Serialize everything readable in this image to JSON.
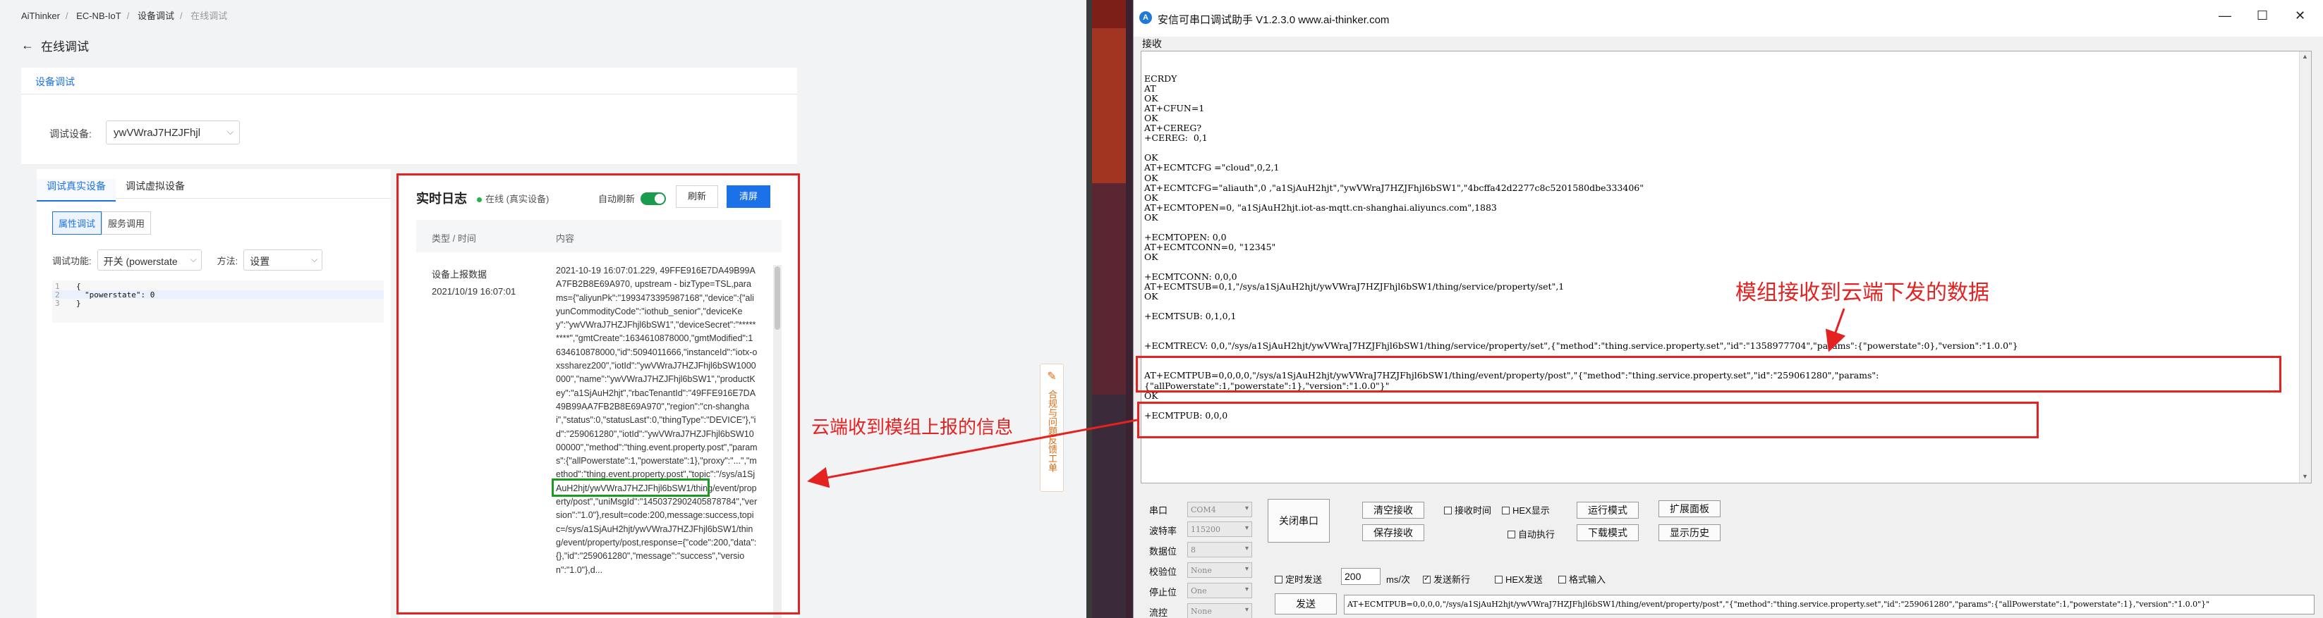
{
  "console": {
    "breadcrumb": [
      "AiThinker",
      "EC-NB-IoT",
      "设备调试",
      "在线调试"
    ],
    "back_label": "在线调试",
    "top_tab": "设备调试",
    "device_label": "调试设备:",
    "device_value": "ywVWraJ7HZJFhjl",
    "subtabs": [
      "调试真实设备",
      "调试虚拟设备"
    ],
    "seg": [
      "属性调试",
      "服务调用"
    ],
    "func_label": "调试功能:",
    "func_value": "开关 (powerstate",
    "method_label": "方法:",
    "method_value": "设置",
    "code": {
      "ln1": "1",
      "ln2": "2",
      "ln3": "3",
      "line1": "{",
      "line2": "\"powerstate\": 0",
      "line3": "}"
    },
    "log": {
      "title": "实时日志",
      "status": "在线 (真实设备)",
      "auto_refresh": "自动刷新",
      "refresh": "刷新",
      "clear": "清屏",
      "col_type": "类型 / 时间",
      "col_content": "内容",
      "entry_type": "设备上报数据",
      "entry_time": "2021/10/19 16:07:01",
      "entry_content": "2021-10-19 16:07:01.229, 49FFE916E7DA49B99AA7FB2B8E69A970, upstream - bizType=TSL,params={\"aliyunPk\":\"1993473395987168\",\"device\":{\"aliyunCommodityCode\":\"iothub_senior\",\"deviceKey\":\"ywVWraJ7HZJFhjl6bSW1\",\"deviceSecret\":\"*********\",\"gmtCreate\":1634610878000,\"gmtModified\":1634610878000,\"id\":5094011666,\"instanceId\":\"iotx-oxssharez200\",\"iotId\":\"ywVWraJ7HZJFhjl6bSW1000000\",\"name\":\"ywVWraJ7HZJFhjl6bSW1\",\"productKey\":\"a1SjAuH2hjt\",\"rbacTenantId\":\"49FFE916E7DA49B99AA7FB2B8E69A970\",\"region\":\"cn-shanghai\",\"status\":0,\"statusLast\":0,\"thingType\":\"DEVICE\"},\"id\":\"259061280\",\"iotId\":\"ywVWraJ7HZJFhjl6bSW1000000\",\"method\":\"thing.event.property.post\",\"params\":{\"allPowerstate\":1,\"powerstate\":1},\"proxy\":\"...\",\"method\":\"thing.event.property.post\",\"topic\":\"/sys/a1SjAuH2hjt/ywVWraJ7HZJFhjl6bSW1/thing/event/property/post\",\"uniMsgId\":\"1450372902405878784\",\"version\":\"1.0\"},result=code:200,message:success,topic=/sys/a1SjAuH2hjt/ywVWraJ7HZJFhjl6bSW1/thing/event/property/post,response={\"code\":200,\"data\":{},\"id\":\"259061280\",\"message\":\"success\",\"version\":\"1.0\"},d..."
    },
    "feedback": "合规与问题反馈工单",
    "annotation": "云端收到模组上报的信息"
  },
  "serial": {
    "title": "安信可串口调试助手 V1.2.3.0    www.ai-thinker.com",
    "recv_label": "接收",
    "annotation": "模组接收到云端下发的数据",
    "recv_lines": [
      "",
      "ECRDY",
      "AT",
      "OK",
      "AT+CFUN=1",
      "OK",
      "AT+CEREG?",
      "+CEREG:  0,1",
      "",
      "OK",
      "AT+ECMTCFG =\"cloud\",0,2,1",
      "OK",
      "AT+ECMTCFG=\"aliauth\",0 ,\"a1SjAuH2hjt\",\"ywVWraJ7HZJFhjl6bSW1\",\"4bcffa42d2277c8c5201580dbe333406\"",
      "OK",
      "AT+ECMTOPEN=0, \"a1SjAuH2hjt.iot-as-mqtt.cn-shanghai.aliyuncs.com\",1883",
      "OK",
      "",
      "+ECMTOPEN: 0,0",
      "AT+ECMTCONN=0, \"12345\"",
      "OK",
      "",
      "+ECMTCONN: 0,0,0",
      "AT+ECMTSUB=0,1,\"/sys/a1SjAuH2hjt/ywVWraJ7HZJFhjl6bSW1/thing/service/property/set\",1",
      "OK",
      "",
      "+ECMTSUB: 0,1,0,1",
      "",
      "",
      "+ECMTRECV: 0,0,\"/sys/a1SjAuH2hjt/ywVWraJ7HZJFhjl6bSW1/thing/service/property/set\",{\"method\":\"thing.service.property.set\",\"id\":\"1358977704\",\"params\":{\"powerstate\":0},\"version\":\"1.0.0\"}",
      "",
      "",
      "AT+ECMTPUB=0,0,0,0,\"/sys/a1SjAuH2hjt/ywVWraJ7HZJFhjl6bSW1/thing/event/property/post\",\"{\"method\":\"thing.service.property.set\",\"id\":\"259061280\",\"params\":",
      "{\"allPowerstate\":1,\"powerstate\":1},\"version\":\"1.0.0\"}\"",
      "OK",
      "",
      "+ECMTPUB: 0,0,0"
    ],
    "port_label": "串口",
    "port_value": "COM4",
    "baud_label": "波特率",
    "baud_value": "115200",
    "databits_label": "数据位",
    "databits_value": "8",
    "parity_label": "校验位",
    "parity_value": "None",
    "stopbits_label": "停止位",
    "stopbits_value": "One",
    "flow_label": "流控",
    "flow_value": "None",
    "close_port": "关闭串口",
    "clear_recv": "清空接收",
    "save_recv": "保存接收",
    "recv_time": "接收时间",
    "hex_show": "HEX显示",
    "auto_exec": "自动执行",
    "run_mode": "运行模式",
    "download_mode": "下载模式",
    "ext_panel": "扩展面板",
    "show_history": "显示历史",
    "timed_send": "定时发送",
    "interval": "200",
    "interval_unit": "ms/次",
    "send_newline": "发送新行",
    "hex_send": "HEX发送",
    "format_input": "格式输入",
    "send": "发送",
    "send_text": "AT+ECMTPUB=0,0,0,0,\"/sys/a1SjAuH2hjt/ywVWraJ7HZJFhjl6bSW1/thing/event/property/post\",\"{\"method\":\"thing.service.property.set\",\"id\":\"259061280\",\"params\":{\"allPowerstate\":1,\"powerstate\":1},\"version\":\"1.0.0\"}\""
  },
  "colors": {
    "accent": "#1b72e8",
    "annotation": "#e52222",
    "highlight": "#1c9b22"
  }
}
